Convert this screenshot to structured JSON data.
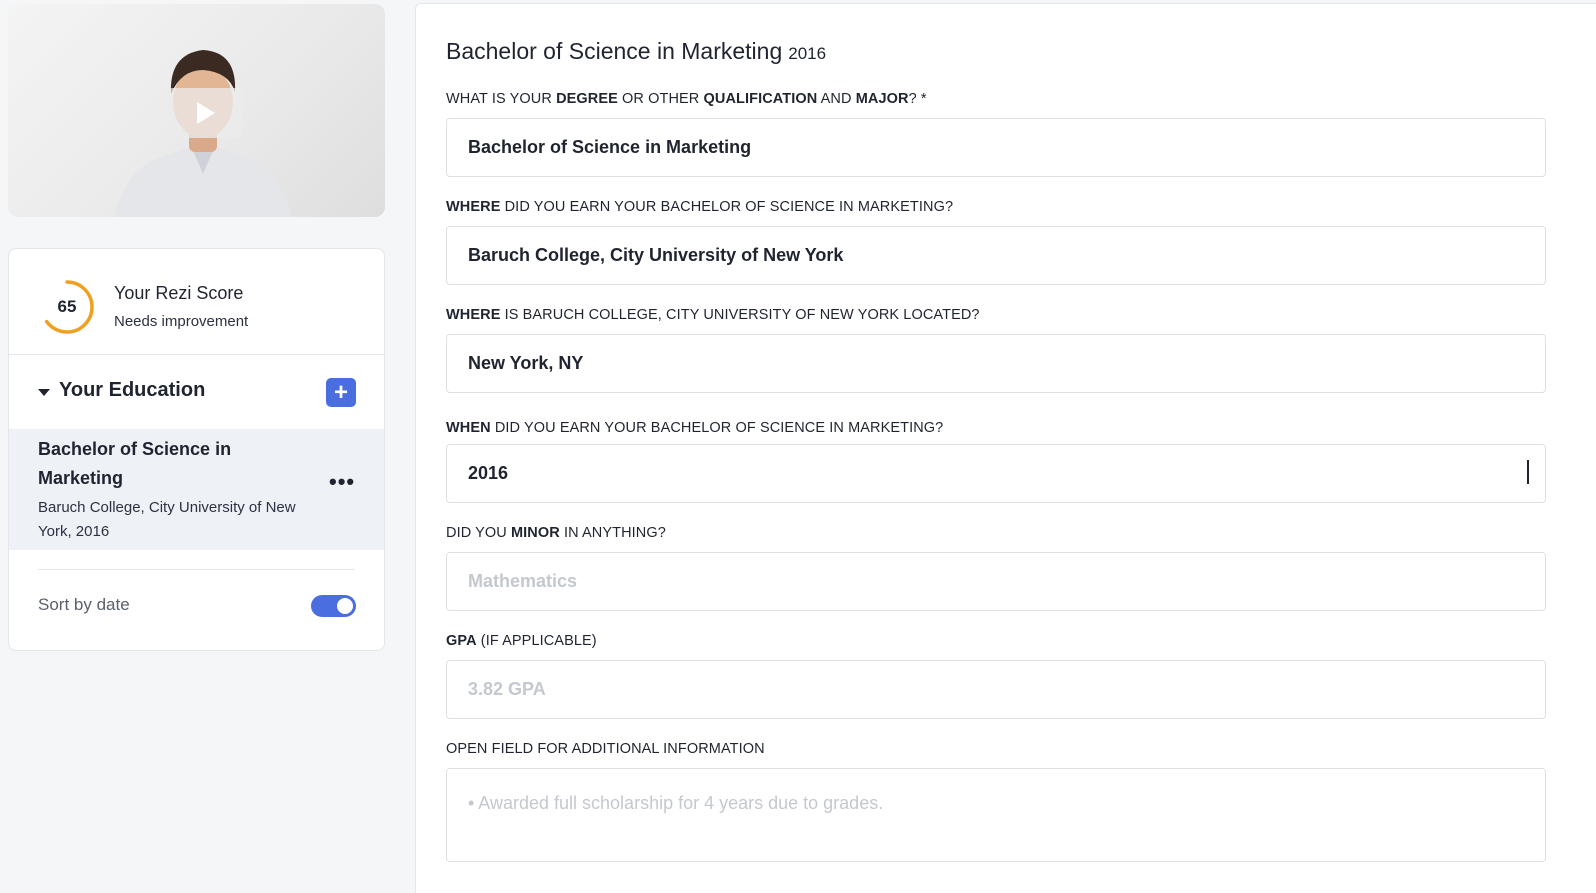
{
  "score": {
    "value": "65",
    "percent": 65,
    "title": "Your Rezi Score",
    "status": "Needs improvement",
    "ring_color": "#f0a020"
  },
  "education": {
    "section_title": "Your Education",
    "add_label": "+",
    "item": {
      "title": "Bachelor of Science in Marketing",
      "subtitle": "Baruch College, City University of New York, 2016",
      "menu_label": "•••"
    },
    "sort_label": "Sort by date",
    "sort_enabled": true
  },
  "form": {
    "title": "Bachelor of Science in Marketing",
    "year": "2016",
    "degree": {
      "label_parts": [
        "WHAT IS YOUR ",
        "DEGREE",
        " OR OTHER ",
        "QUALIFICATION",
        " AND ",
        "MAJOR",
        "? *"
      ],
      "value": "Bachelor of Science in Marketing"
    },
    "school": {
      "label_parts": [
        "WHERE",
        " DID YOU EARN YOUR BACHELOR OF SCIENCE IN MARKETING?"
      ],
      "value": "Baruch College, City University of New York"
    },
    "location": {
      "label_parts": [
        "WHERE",
        " IS BARUCH COLLEGE, CITY UNIVERSITY OF NEW YORK LOCATED?"
      ],
      "value": "New York, NY"
    },
    "date": {
      "label_parts": [
        "WHEN",
        " DID YOU EARN YOUR BACHELOR OF SCIENCE IN MARKETING?"
      ],
      "value": "2016"
    },
    "minor": {
      "label_parts": [
        "DID YOU ",
        "MINOR",
        " IN ANYTHING?"
      ],
      "placeholder": "Mathematics"
    },
    "gpa": {
      "label_parts": [
        "GPA",
        " (IF APPLICABLE)"
      ],
      "placeholder": "3.82 GPA"
    },
    "additional": {
      "label": "OPEN FIELD FOR ADDITIONAL INFORMATION",
      "placeholder": "• Awarded full scholarship for 4 years due to grades."
    }
  },
  "colors": {
    "accent": "#4a6ee0",
    "score_ring": "#f0a020"
  }
}
